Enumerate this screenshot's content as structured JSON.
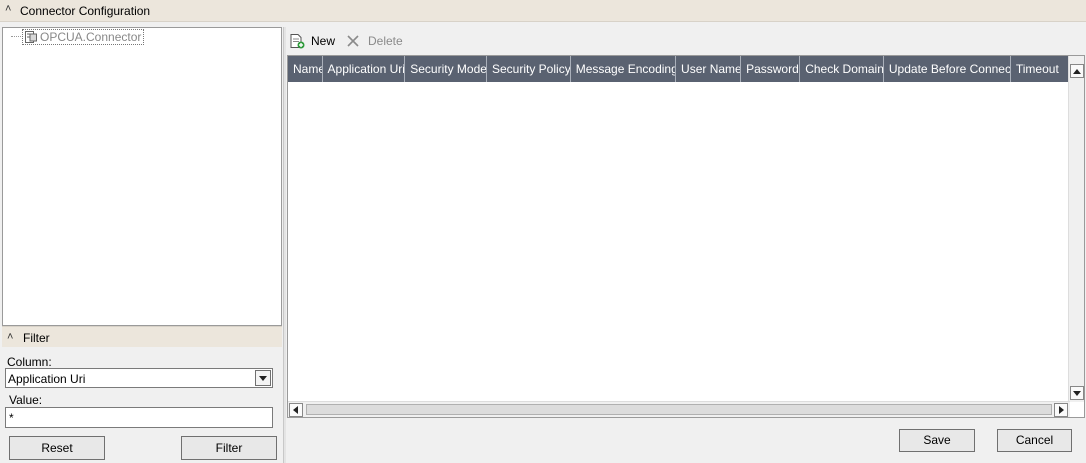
{
  "header": {
    "title": "Connector Configuration"
  },
  "tree": {
    "root_label": "OPCUA.Connector"
  },
  "filter": {
    "title": "Filter",
    "column_label": "Column:",
    "column_value": "Application Uri",
    "value_label": "Value:",
    "value_text": "*",
    "reset_label": "Reset",
    "filter_label": "Filter"
  },
  "toolbar": {
    "new_label": "New",
    "delete_label": "Delete"
  },
  "grid": {
    "columns": [
      "Name",
      "Application Uri",
      "Security Mode",
      "Security Policy",
      "Message Encoding",
      "User Name",
      "Password",
      "Check Domain",
      "Update Before Connect",
      "Timeout"
    ],
    "rows": []
  },
  "actions": {
    "save_label": "Save",
    "cancel_label": "Cancel"
  },
  "colors": {
    "header_bg": "#5a6271",
    "panel_bar": "#ece6dc"
  }
}
